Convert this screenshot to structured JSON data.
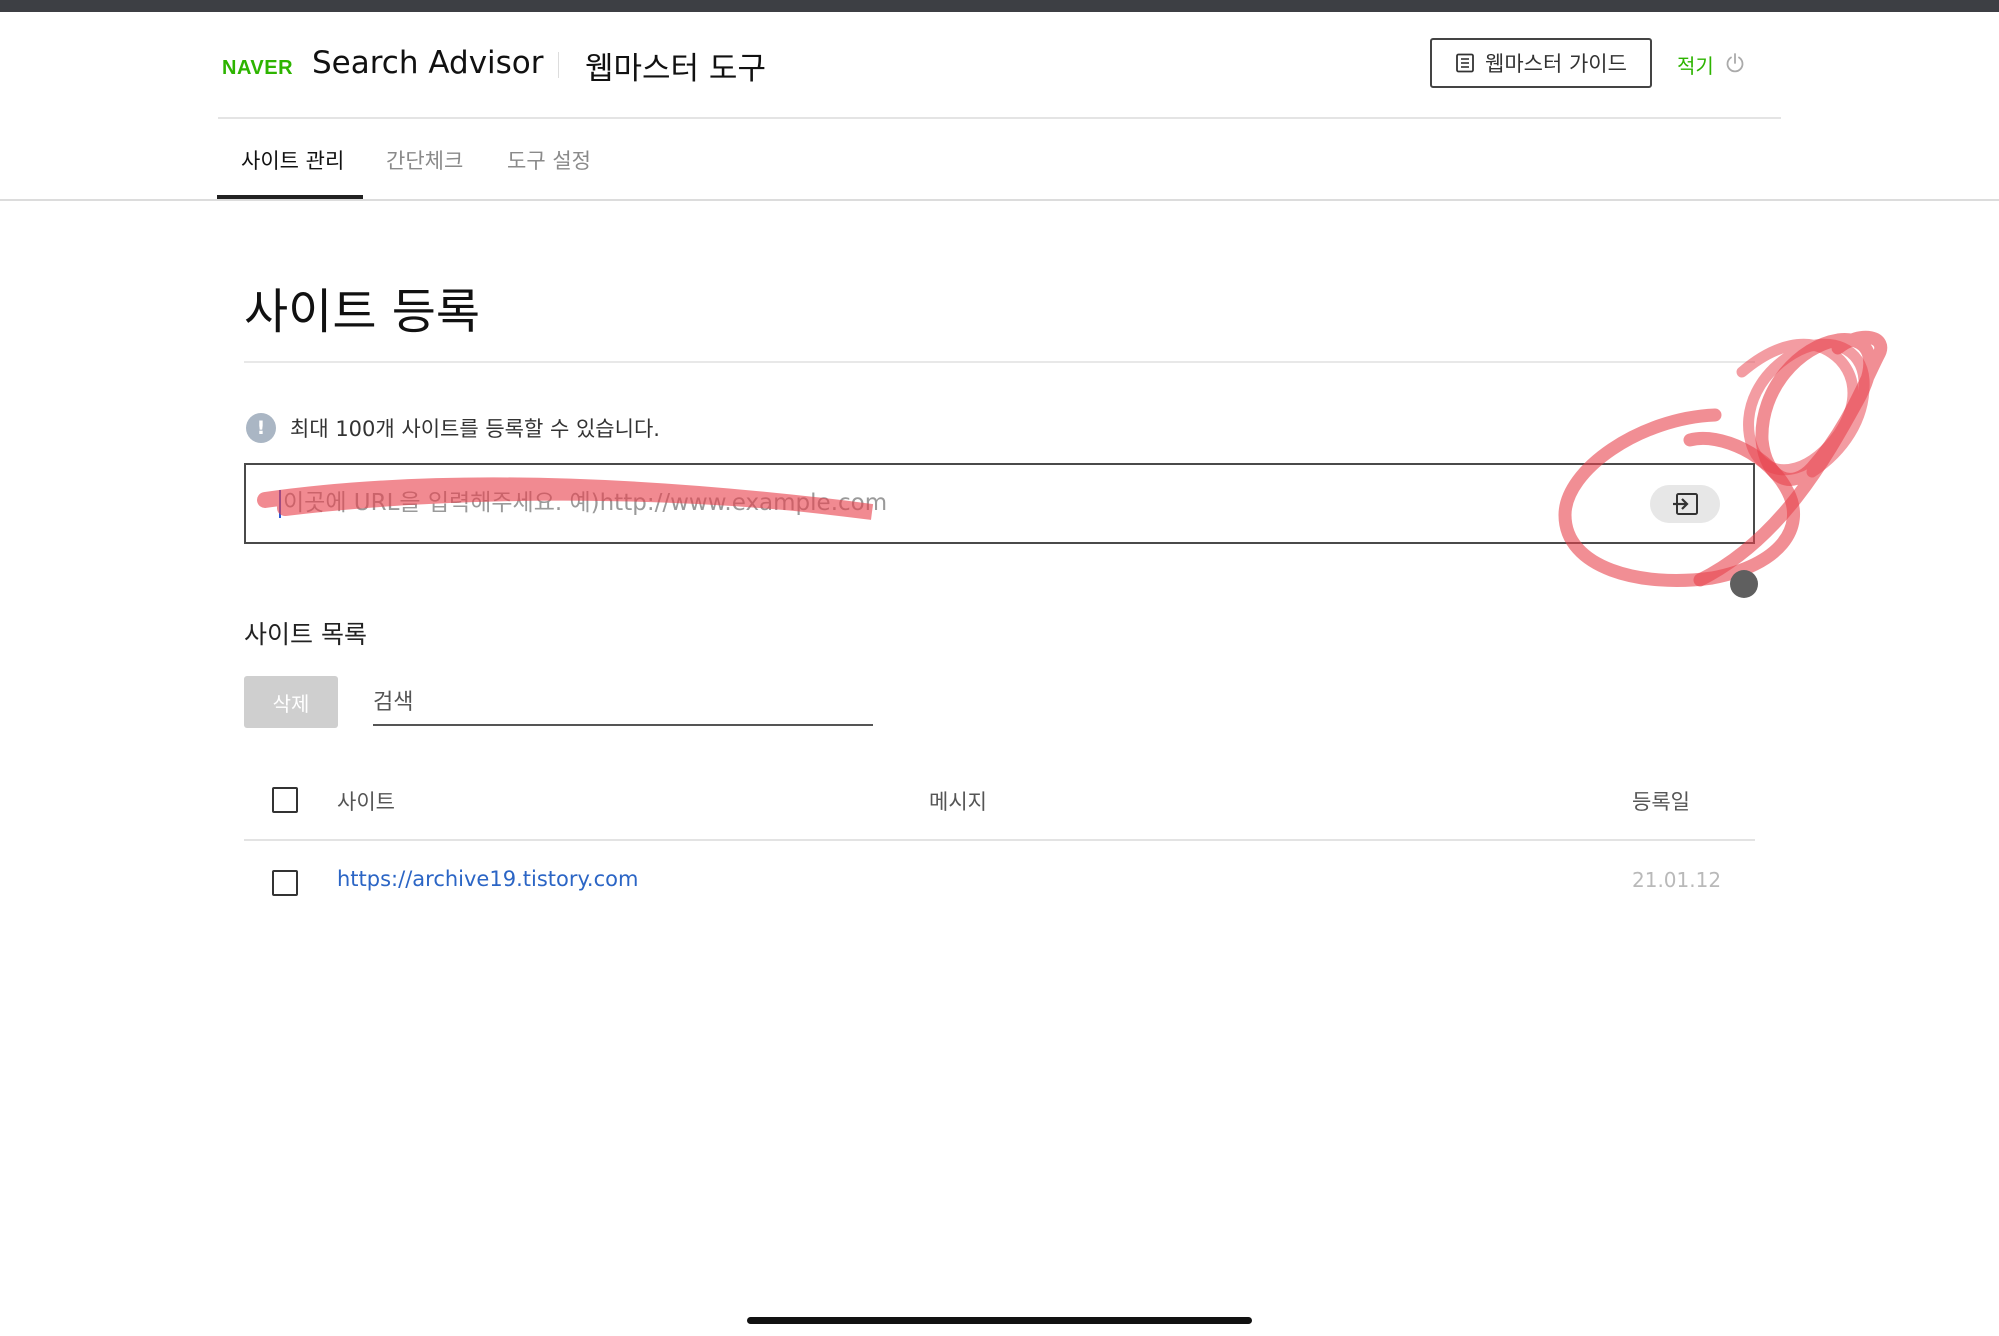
{
  "header": {
    "logo": "NAVER",
    "app_title": "Search Advisor",
    "tool_title": "웹마스터 도구",
    "guide_button": "웹마스터 가이드",
    "user_name": "적기"
  },
  "tabs": [
    {
      "label": "사이트 관리",
      "active": true
    },
    {
      "label": "간단체크",
      "active": false
    },
    {
      "label": "도구 설정",
      "active": false
    }
  ],
  "main": {
    "page_title": "사이트 등록",
    "notice_icon": "!",
    "notice": "최대 100개 사이트를 등록할 수 있습니다.",
    "url_input": {
      "value": "",
      "placeholder": "이곳에 URL을 입력해주세요. 예)http://www.example.com"
    }
  },
  "site_list": {
    "title": "사이트 목록",
    "delete_button": "삭제",
    "search_placeholder": "검색",
    "columns": {
      "site": "사이트",
      "message": "메시지",
      "date": "등록일"
    },
    "rows": [
      {
        "site": "https://archive19.tistory.com",
        "message": "",
        "date": "21.01.12"
      }
    ]
  },
  "icons": {
    "guide": "book-list-icon",
    "logout": "power-icon",
    "submit": "enter-arrow-icon",
    "notice": "info-icon"
  },
  "colors": {
    "brand_green": "#2db400",
    "link_blue": "#2b65c5",
    "annotation_red": "#e8424d"
  }
}
